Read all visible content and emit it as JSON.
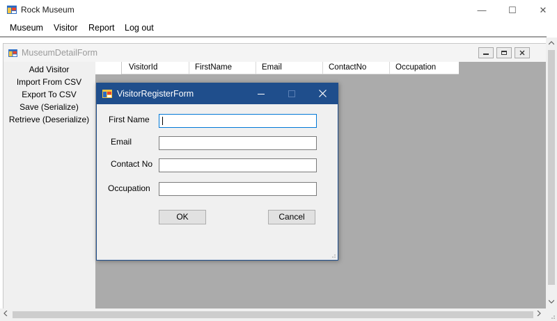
{
  "window": {
    "title": "Rock Museum",
    "minimize_glyph": "—",
    "maximize_glyph": "☐",
    "close_glyph": "✕"
  },
  "menu": {
    "items": [
      {
        "label": "Museum"
      },
      {
        "label": "Visitor"
      },
      {
        "label": "Report"
      },
      {
        "label": "Log out"
      }
    ]
  },
  "child_form": {
    "title": "MuseumDetailForm",
    "side_buttons": [
      {
        "label": "Add Visitor"
      },
      {
        "label": "Import From  CSV"
      },
      {
        "label": "Export To CSV"
      },
      {
        "label": "Save (Serialize)"
      },
      {
        "label": "Retrieve (Deserialize)"
      }
    ],
    "grid_columns": [
      "VisitorId",
      "FirstName",
      "Email",
      "ContactNo",
      "Occupation"
    ]
  },
  "dialog": {
    "title": "VisitorRegisterForm",
    "fields": [
      {
        "label": "First Name",
        "value": ""
      },
      {
        "label": "Email",
        "value": ""
      },
      {
        "label": "Contact No",
        "value": ""
      },
      {
        "label": "Occupation",
        "value": ""
      }
    ],
    "ok_label": "OK",
    "cancel_label": "Cancel"
  },
  "colors": {
    "dialog_title_bg": "#1f4e8c",
    "mdi_background": "#ababab",
    "focus_border": "#0078d7"
  },
  "icons": [
    "app-form-icon",
    "minimize-icon",
    "maximize-icon",
    "close-icon",
    "scroll-up-icon",
    "scroll-down-icon",
    "scroll-left-icon",
    "scroll-right-icon",
    "resize-grip-icon"
  ]
}
